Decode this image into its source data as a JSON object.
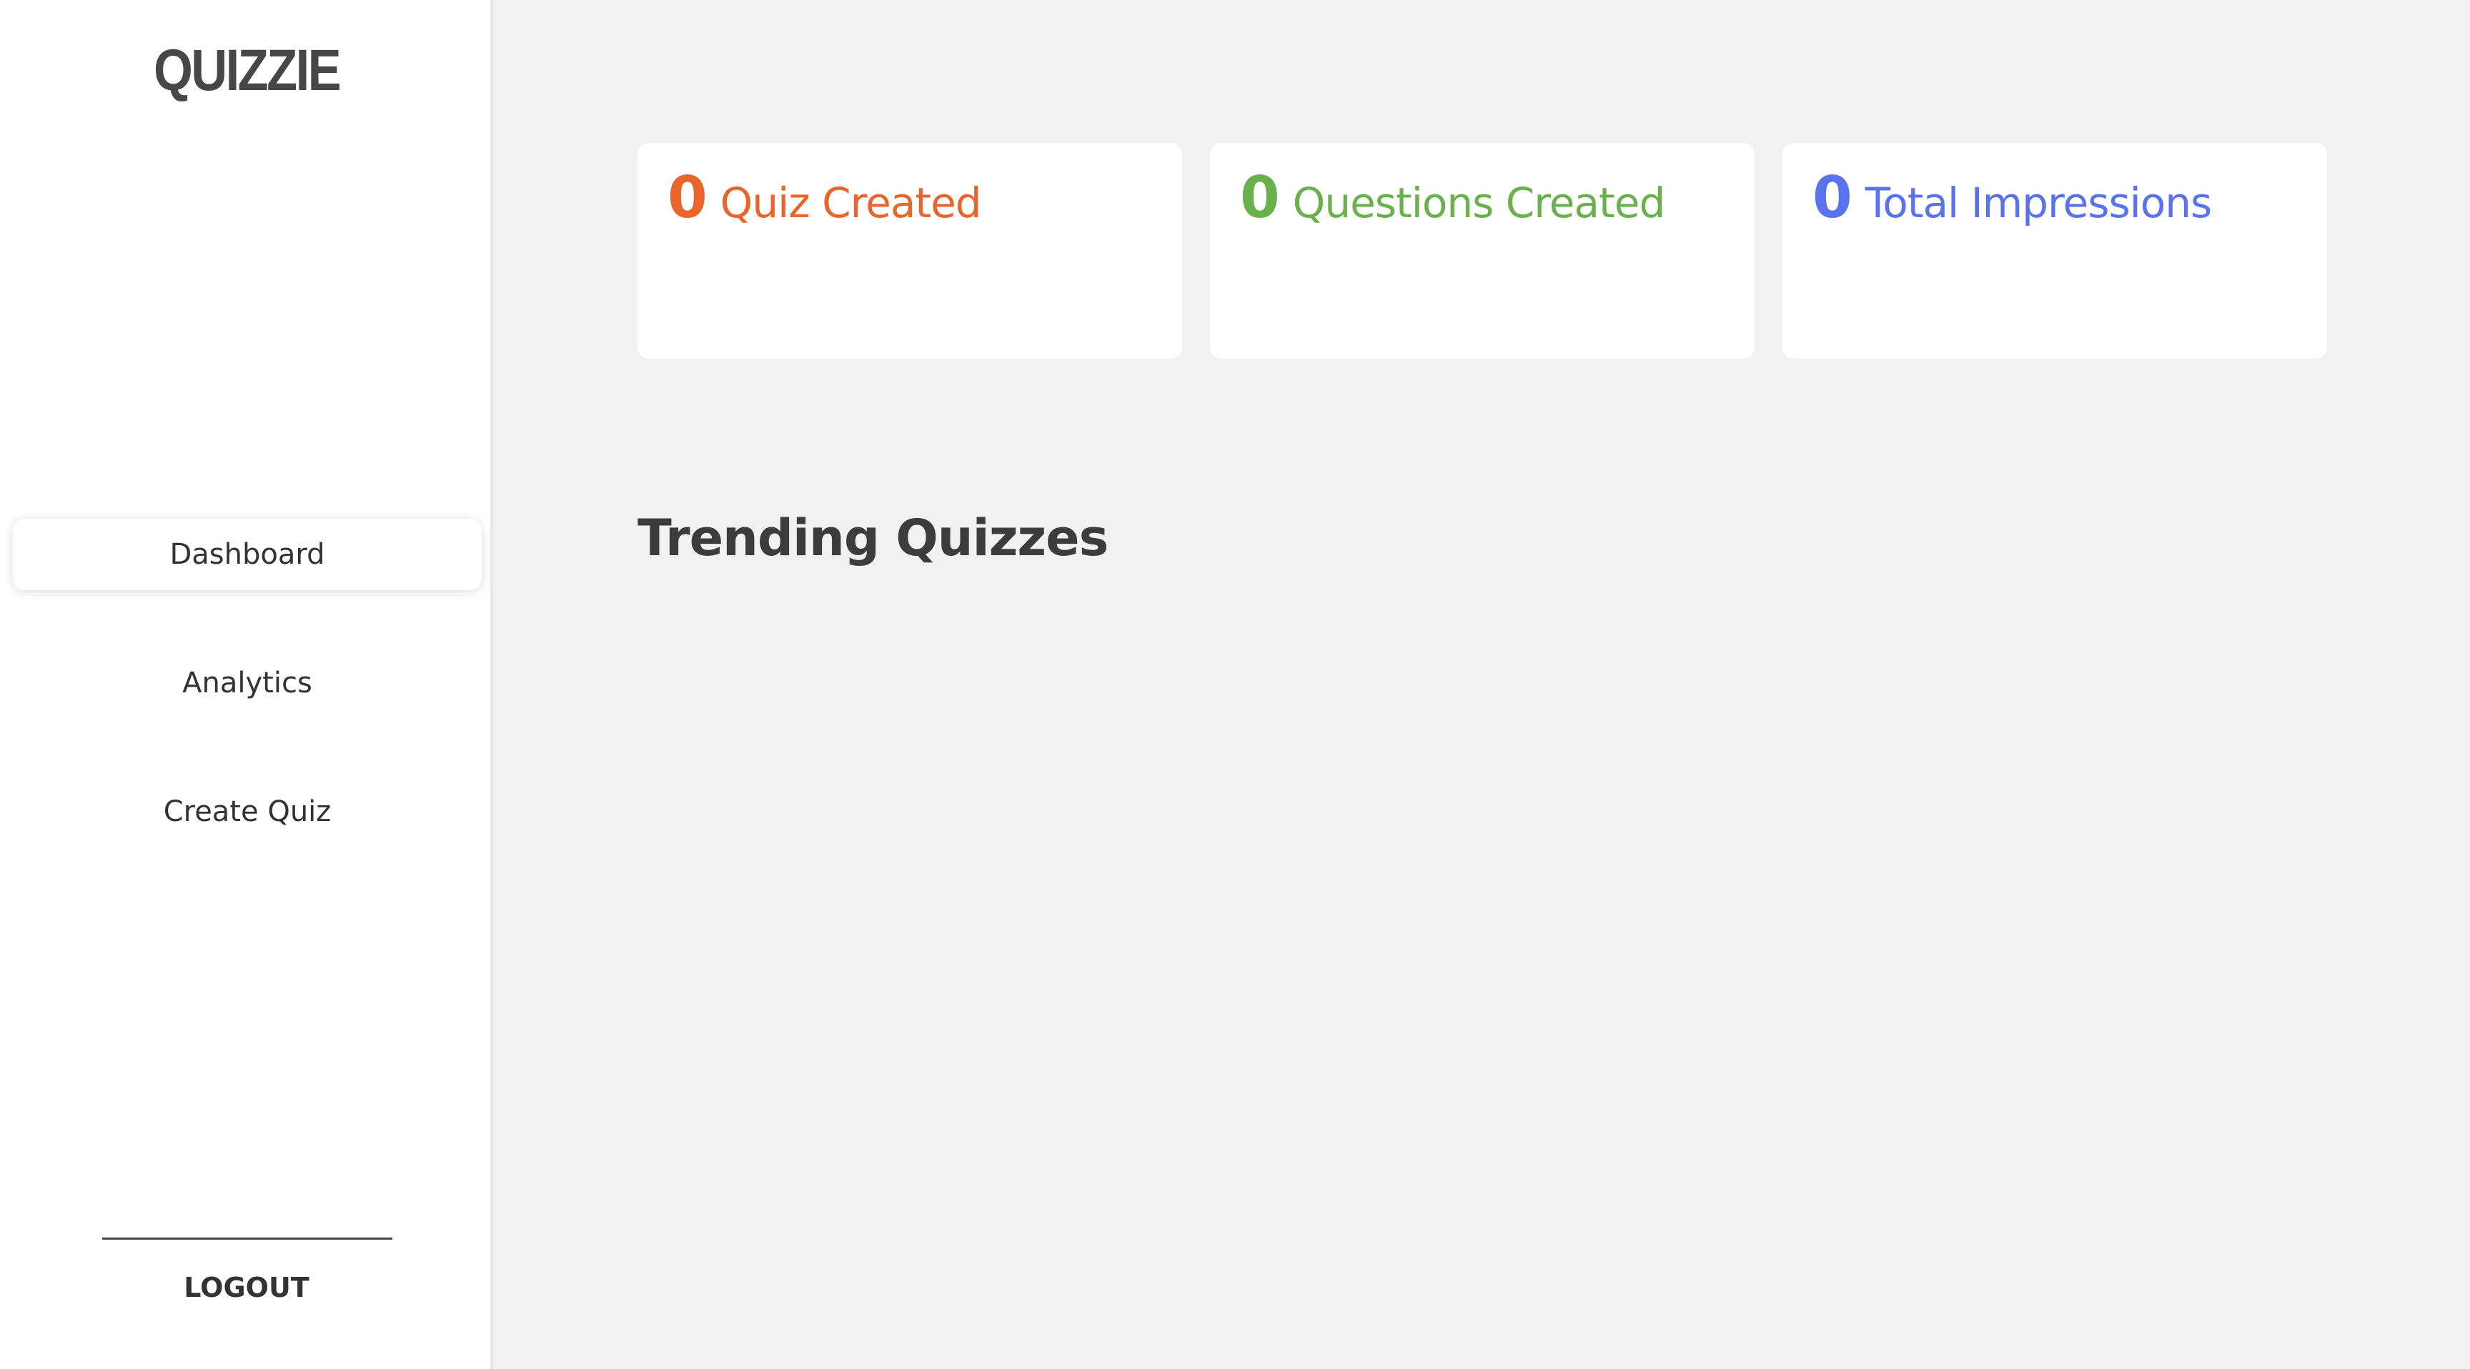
{
  "app": {
    "logo": "QUIZZIE"
  },
  "sidebar": {
    "items": [
      {
        "label": "Dashboard",
        "active": true
      },
      {
        "label": "Analytics",
        "active": false
      },
      {
        "label": "Create Quiz",
        "active": false
      }
    ],
    "logout_label": "LOGOUT"
  },
  "stats": [
    {
      "value": "0",
      "label": "Quiz Created",
      "color": "#e8652b"
    },
    {
      "value": "0",
      "label": "Questions Created",
      "color": "#6ab04c"
    },
    {
      "value": "0",
      "label": "Total Impressions",
      "color": "#5b72ee"
    }
  ],
  "main": {
    "section_title": "Trending Quizzes"
  }
}
